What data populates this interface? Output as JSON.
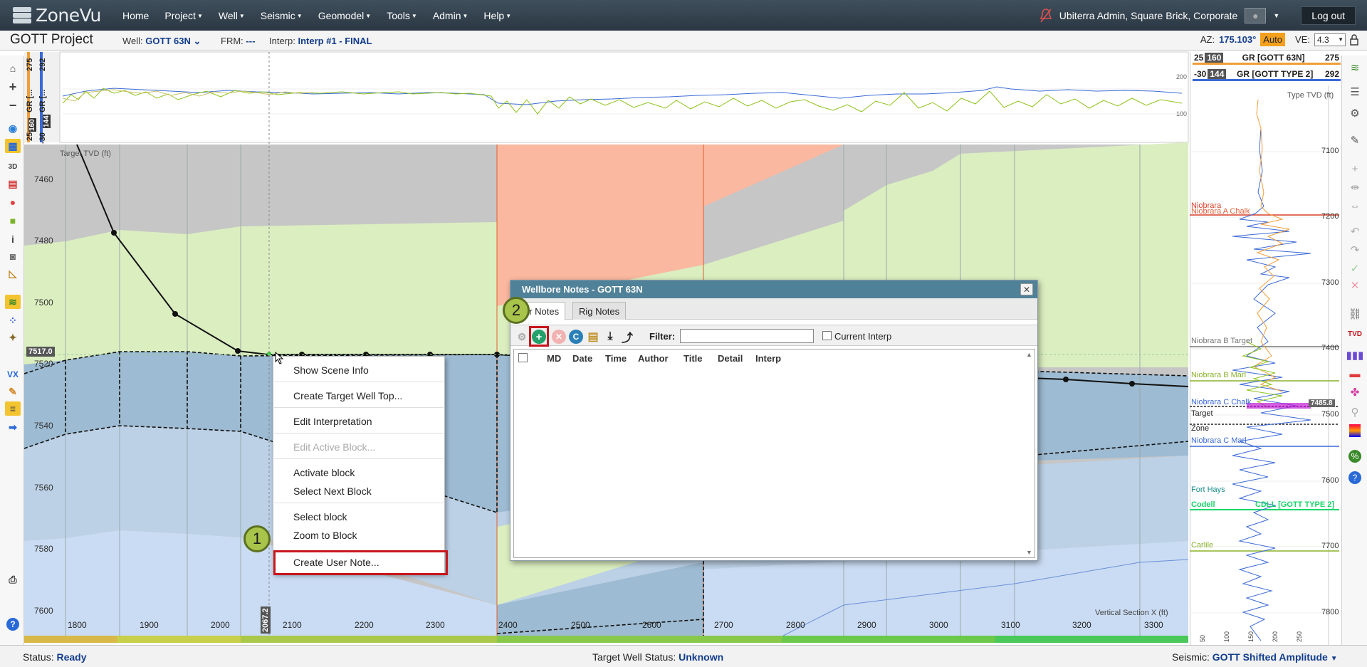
{
  "nav": {
    "logo_text": "ZoneVu",
    "items": [
      {
        "label": "Home",
        "has_caret": false
      },
      {
        "label": "Project",
        "has_caret": true
      },
      {
        "label": "Well",
        "has_caret": true
      },
      {
        "label": "Seismic",
        "has_caret": true
      },
      {
        "label": "Geomodel",
        "has_caret": true
      },
      {
        "label": "Tools",
        "has_caret": true
      },
      {
        "label": "Admin",
        "has_caret": true
      },
      {
        "label": "Help",
        "has_caret": true
      }
    ],
    "user": "Ubiterra Admin, Square Brick, Corporate",
    "logout": "Log out"
  },
  "subbar": {
    "project_title": "GOTT Project",
    "well_label": "Well:",
    "well_value": "GOTT 63N",
    "frm_label": "FRM:",
    "frm_value": "---",
    "interp_label": "Interp:",
    "interp_value": "Interp #1 - FINAL",
    "az_label": "AZ:",
    "az_value": "175.103°",
    "auto_label": "Auto",
    "ve_label": "VE:",
    "ve_value": "4.3"
  },
  "top_log": {
    "left_labels": [
      {
        "min": "25",
        "badge": "160",
        "name": "GR [...",
        "max": "275"
      },
      {
        "min": "-30",
        "badge": "144",
        "name": "GR [...",
        "max": "292"
      }
    ],
    "scale_ticks": [
      "200",
      "100"
    ]
  },
  "cross_section": {
    "y_axis_title": "Target TVD (ft)",
    "y_ticks": [
      "7460",
      "7480",
      "7500",
      "7520",
      "7540",
      "7560",
      "7580",
      "7600"
    ],
    "x_axis_title": "Vertical Section X (ft)",
    "x_ticks": [
      "1800",
      "1900",
      "2000",
      "2100",
      "2200",
      "2300",
      "2400",
      "2500",
      "2600",
      "2700",
      "2800",
      "2900",
      "3000",
      "3100",
      "3200",
      "3300"
    ],
    "cursor_tvd": "7517.0",
    "cursor_x": "2067.2"
  },
  "context_menu": {
    "items": [
      {
        "label": "Show Scene Info",
        "disabled": false
      },
      {
        "label": "Create Target Well Top...",
        "disabled": false
      },
      {
        "label": "Edit Interpretation",
        "disabled": false
      },
      {
        "label": "Edit Active Block...",
        "disabled": true
      },
      {
        "label": "Activate block",
        "disabled": false
      },
      {
        "label": "Select Next Block",
        "disabled": false
      },
      {
        "label": "Select block",
        "disabled": false
      },
      {
        "label": "Zoom to Block",
        "disabled": false
      },
      {
        "label": "Create User Note...",
        "disabled": false
      }
    ]
  },
  "callouts": {
    "step1": "1",
    "step2": "2"
  },
  "dialog": {
    "title": "Wellbore Notes - GOTT 63N",
    "tabs": [
      {
        "label": "User Notes",
        "shown_text": "er Notes",
        "active": true
      },
      {
        "label": "Rig Notes",
        "active": false
      }
    ],
    "filter_label": "Filter:",
    "filter_value": "",
    "current_interp_label": "Current Interp",
    "columns": [
      "MD",
      "Date",
      "Time",
      "Author",
      "Title",
      "Detail",
      "Interp"
    ]
  },
  "right_panel": {
    "curves": [
      {
        "min": "25",
        "badge": "160",
        "name": "GR [GOTT 63N]",
        "max": "275",
        "color": "#f09d3a"
      },
      {
        "min": "-30",
        "badge": "144",
        "name": "GR [GOTT TYPE 2]",
        "max": "292",
        "color": "#3b69d6"
      }
    ],
    "axis_title": "Type TVD (ft)",
    "tvd_ticks": [
      "7100",
      "7200",
      "7300",
      "7400",
      "7500",
      "7600",
      "7700",
      "7800"
    ],
    "gr_ticks": [
      "50",
      "100",
      "150",
      "200",
      "250"
    ],
    "tops": [
      {
        "label": "Niobrara",
        "color": "#d9402a"
      },
      {
        "label": "Niobrara A Chalk",
        "color": "#e0603a"
      },
      {
        "label": "Niobrara B Target",
        "color": "#777777"
      },
      {
        "label": "Niobrara B Marl",
        "color": "#8ab22a"
      },
      {
        "label": "Niobrara C Chalk",
        "color": "#3a6ad6"
      },
      {
        "label": "Target",
        "color": "#222222"
      },
      {
        "label": "Zone",
        "color": "#222222"
      },
      {
        "label": "Niobrara C Marl",
        "color": "#3a6ad6"
      },
      {
        "label": "Fort Hays",
        "color": "#1a8a8a"
      },
      {
        "label": "Codell",
        "color": "#1ad66a"
      },
      {
        "label": "CDLL [GOTT TYPE 2]",
        "color": "#1ad66a"
      },
      {
        "label": "Carlile",
        "color": "#8ab22a"
      }
    ],
    "marker_value": "7485.8"
  },
  "status": {
    "status_label": "Status:",
    "status_value": "Ready",
    "target_label": "Target Well Status:",
    "target_value": "Unknown",
    "seismic_label": "Seismic:",
    "seismic_value": "GOTT Shifted Amplitude"
  },
  "left_tools": [
    "home-icon",
    "zoom-in-icon",
    "zoom-out-icon",
    "compass-icon",
    "grid-icon",
    "3d-icon",
    "seismic-icon",
    "layers-icon",
    "cube-icon",
    "info-icon",
    "camera-icon",
    "ruler-icon",
    "horizon-icon",
    "points-icon",
    "target-icon",
    "vx-icon",
    "pencil-icon",
    "notes-icon",
    "arrow-icon",
    "print-icon",
    "help-icon"
  ],
  "right_tools": [
    "layers-icon",
    "list-icon",
    "gear-icon",
    "pencil-icon",
    "plus-icon",
    "split-icon",
    "merge-icon",
    "undo-icon",
    "redo-icon",
    "check-icon",
    "cancel-icon",
    "link-icon",
    "tvd-icon",
    "bars-icon",
    "flag-icon",
    "search-icon",
    "gradient-icon",
    "percent-icon",
    "help-icon"
  ]
}
